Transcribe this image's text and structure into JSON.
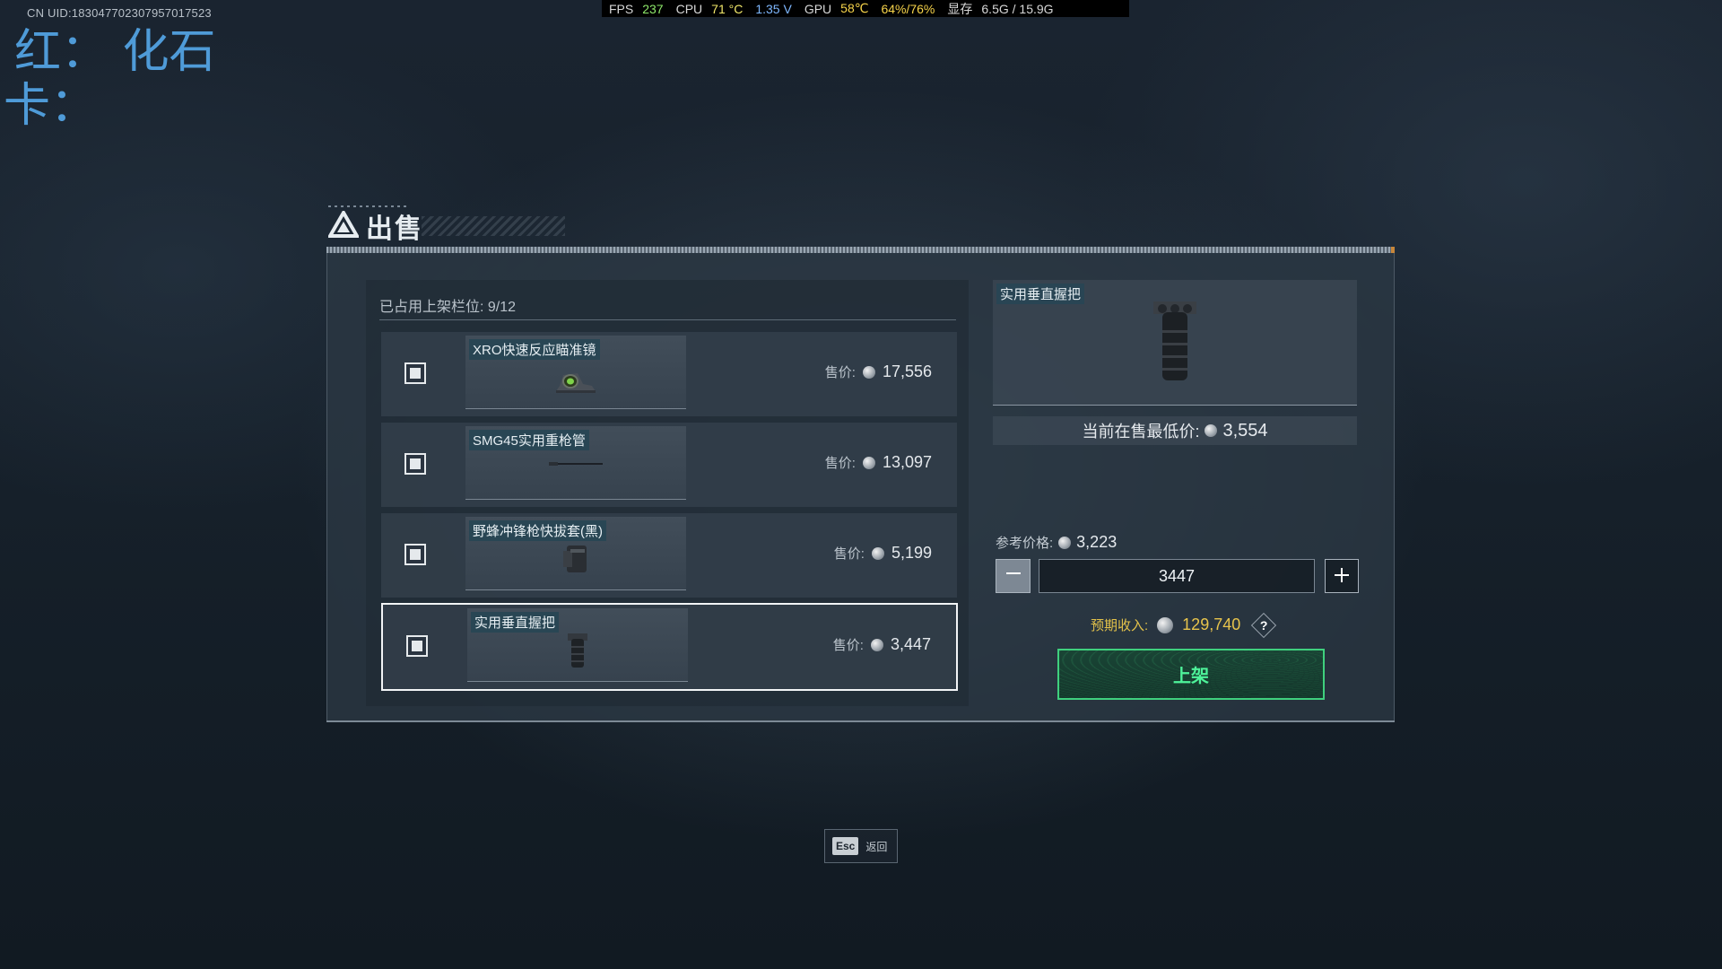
{
  "uid": "CN UID:183047702307957017523",
  "perf": {
    "fps_label": "FPS",
    "fps": "237",
    "cpu_label": "CPU",
    "cpu_temp": "71 °C",
    "cpu_volt": "1.35 V",
    "gpu_label": "GPU",
    "gpu_temp": "58℃",
    "gpu_usage": "64%/76%",
    "vram_label": "显存",
    "vram": "6.5G / 15.9G"
  },
  "overlay": {
    "line1": "红：  化石",
    "line2": "卡："
  },
  "dialog": {
    "title": "出售",
    "slots_label": "已占用上架栏位: 9/12",
    "price_label": "售价:",
    "items": [
      {
        "name": "XRO快速反应瞄准镜",
        "price": "17,556",
        "icon": "scope-icon"
      },
      {
        "name": "SMG45实用重枪管",
        "price": "13,097",
        "icon": "barrel-icon"
      },
      {
        "name": "野蜂冲锋枪快拔套(黑)",
        "price": "5,199",
        "icon": "holster-icon"
      },
      {
        "name": "实用垂直握把",
        "price": "3,447",
        "icon": "grip-icon"
      }
    ],
    "selected_index": 3
  },
  "detail": {
    "name": "实用垂直握把",
    "lowest_label": "当前在售最低价:",
    "lowest_value": "3,554",
    "ref_label": "参考价格:",
    "ref_value": "3,223",
    "quantity": "3447",
    "income_label": "预期收入:",
    "income_value": "129,740",
    "help": "?",
    "list_button": "上架"
  },
  "footer": {
    "esc_key": "Esc",
    "esc_label": "返回"
  },
  "colors": {
    "accent_green": "#4ef39a",
    "income_gold": "#e8c44c",
    "overlay_blue": "#4f9bd8"
  }
}
